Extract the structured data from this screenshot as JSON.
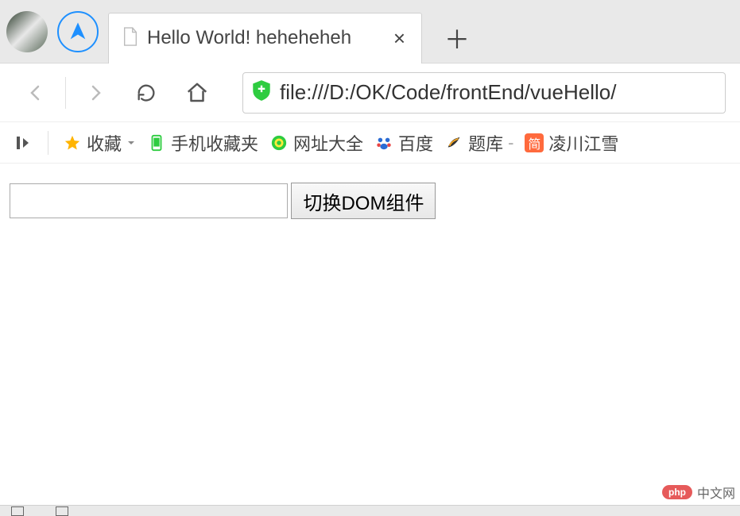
{
  "titlebar": {
    "tab_title": "Hello World! heheheheh",
    "close_glyph": "×",
    "newtab_glyph": "＋"
  },
  "navbar": {
    "url": "file:///D:/OK/Code/frontEnd/vueHello/"
  },
  "bookmarks": {
    "favorites_label": "收藏",
    "mobile_fav_label": "手机收藏夹",
    "site_daquan_label": "网址大全",
    "baidu_label": "百度",
    "tiku_label": "题库",
    "tiku_suffix": "-",
    "lingchuan_label": "凌川江雪",
    "jian_glyph": "简"
  },
  "page": {
    "input_value": "",
    "button_label": "切换DOM组件"
  },
  "watermark": {
    "badge": "php",
    "text": "中文网"
  }
}
